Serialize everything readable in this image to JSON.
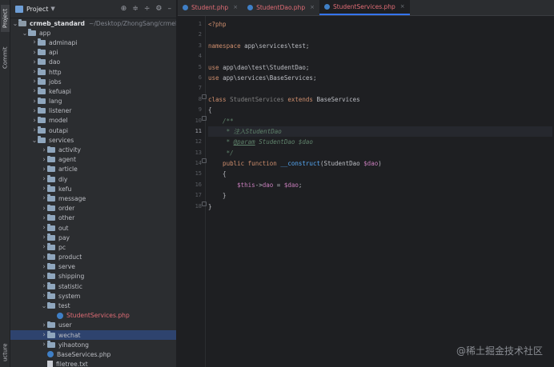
{
  "toolstrip": {
    "project_tab": "Project",
    "commit_tab": "Commit",
    "structure_tab": "ucture"
  },
  "project_panel": {
    "title": "Project",
    "icons": [
      "locate-icon",
      "collapse-icon",
      "expand-icon",
      "settings-icon",
      "minimize-icon"
    ]
  },
  "tree": [
    {
      "label": "crmeb_standard",
      "path": "~/Desktop/ZhongSang/crmeb",
      "type": "root",
      "level": 0,
      "open": true,
      "bold": true
    },
    {
      "label": "app",
      "type": "folder",
      "level": 1,
      "open": true
    },
    {
      "label": "adminapi",
      "type": "folder",
      "level": 2
    },
    {
      "label": "api",
      "type": "folder",
      "level": 2
    },
    {
      "label": "dao",
      "type": "folder",
      "level": 2
    },
    {
      "label": "http",
      "type": "folder",
      "level": 2
    },
    {
      "label": "jobs",
      "type": "folder",
      "level": 2
    },
    {
      "label": "kefuapi",
      "type": "folder",
      "level": 2
    },
    {
      "label": "lang",
      "type": "folder",
      "level": 2
    },
    {
      "label": "listener",
      "type": "folder",
      "level": 2
    },
    {
      "label": "model",
      "type": "folder",
      "level": 2
    },
    {
      "label": "outapi",
      "type": "folder",
      "level": 2
    },
    {
      "label": "services",
      "type": "folder",
      "level": 2,
      "open": true
    },
    {
      "label": "activity",
      "type": "folder",
      "level": 3
    },
    {
      "label": "agent",
      "type": "folder",
      "level": 3
    },
    {
      "label": "article",
      "type": "folder",
      "level": 3
    },
    {
      "label": "diy",
      "type": "folder",
      "level": 3
    },
    {
      "label": "kefu",
      "type": "folder",
      "level": 3
    },
    {
      "label": "message",
      "type": "folder",
      "level": 3
    },
    {
      "label": "order",
      "type": "folder",
      "level": 3
    },
    {
      "label": "other",
      "type": "folder",
      "level": 3
    },
    {
      "label": "out",
      "type": "folder",
      "level": 3
    },
    {
      "label": "pay",
      "type": "folder",
      "level": 3
    },
    {
      "label": "pc",
      "type": "folder",
      "level": 3
    },
    {
      "label": "product",
      "type": "folder",
      "level": 3
    },
    {
      "label": "serve",
      "type": "folder",
      "level": 3
    },
    {
      "label": "shipping",
      "type": "folder",
      "level": 3
    },
    {
      "label": "statistic",
      "type": "folder",
      "level": 3
    },
    {
      "label": "system",
      "type": "folder",
      "level": 3
    },
    {
      "label": "test",
      "type": "folder",
      "level": 3,
      "open": true
    },
    {
      "label": "StudentServices.php",
      "type": "php",
      "level": 4,
      "red": true
    },
    {
      "label": "user",
      "type": "folder",
      "level": 3
    },
    {
      "label": "wechat",
      "type": "folder",
      "level": 3,
      "selected": true
    },
    {
      "label": "yihaotong",
      "type": "folder",
      "level": 3
    },
    {
      "label": "BaseServices.php",
      "type": "php",
      "level": 3,
      "leaf": true
    },
    {
      "label": "filetree.txt",
      "type": "txt",
      "level": 3,
      "leaf": true
    }
  ],
  "tabs": [
    {
      "label": "Student.php",
      "active": false
    },
    {
      "label": "StudentDao.php",
      "active": false
    },
    {
      "label": "StudentServices.php",
      "active": true
    }
  ],
  "editor": {
    "current_line": 11,
    "lines": [
      [
        [
          "kw",
          "<?php"
        ]
      ],
      [],
      [
        [
          "kw",
          "namespace "
        ],
        [
          "ns",
          "app\\services\\test;"
        ]
      ],
      [],
      [
        [
          "kw",
          "use "
        ],
        [
          "ns",
          "app\\dao\\test\\StudentDao;"
        ]
      ],
      [
        [
          "kw",
          "use "
        ],
        [
          "ns",
          "app\\services\\BaseServices;"
        ]
      ],
      [],
      [
        [
          "kw",
          "class "
        ],
        [
          "dim",
          "StudentServices "
        ],
        [
          "kw",
          "extends "
        ],
        [
          "cls",
          "BaseServices"
        ]
      ],
      [
        [
          "cls",
          "{"
        ]
      ],
      [
        [
          "cmt",
          "    /**"
        ]
      ],
      [
        [
          "cmt",
          "     * 注入StudentDao"
        ]
      ],
      [
        [
          "cmt",
          "     * "
        ],
        [
          "doctag",
          "@param"
        ],
        [
          "cmt",
          " StudentDao "
        ],
        [
          "cmt",
          "$dao"
        ]
      ],
      [
        [
          "cmt",
          "     */"
        ]
      ],
      [
        [
          "kw",
          "    public function "
        ],
        [
          "fn",
          "__construct"
        ],
        [
          "cls",
          "(StudentDao "
        ],
        [
          "var",
          "$dao"
        ],
        [
          "cls",
          ")"
        ]
      ],
      [
        [
          "cls",
          "    {"
        ]
      ],
      [
        [
          "var",
          "        $this"
        ],
        [
          "cls",
          "->"
        ],
        [
          "var",
          "dao"
        ],
        [
          "cls",
          " = "
        ],
        [
          "var",
          "$dao"
        ],
        [
          "cls",
          ";"
        ]
      ],
      [
        [
          "cls",
          "    }"
        ]
      ],
      [
        [
          "cls",
          "}"
        ]
      ]
    ]
  },
  "watermark": "@稀土掘金技术社区",
  "colors": {
    "accent": "#3574f0",
    "selection": "#2e436e",
    "keyword": "#cf8e6d",
    "modified_file": "#e06c75"
  }
}
